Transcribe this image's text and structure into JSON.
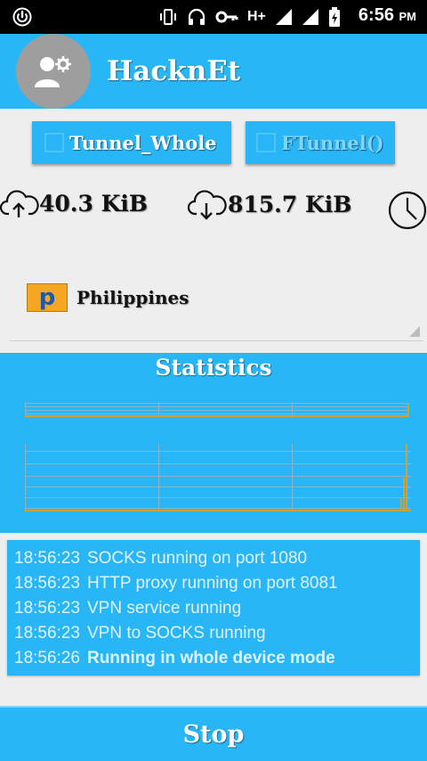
{
  "status_bar": {
    "network_type": "H+",
    "time": "6:56",
    "ampm": "PM",
    "icons": [
      "power-icon",
      "vibrate-icon",
      "headset-icon",
      "key-icon",
      "signal-icon",
      "signal-icon",
      "battery-icon"
    ]
  },
  "header": {
    "title": "HacknEt"
  },
  "modes": [
    {
      "label": "Tunnel_Whole",
      "checked": true
    },
    {
      "label": "FTunnel()",
      "checked": false
    }
  ],
  "traffic": {
    "upload": "40.3 KiB",
    "download": "815.7 KiB"
  },
  "server": {
    "name": "Philippines",
    "flag_letter": "p"
  },
  "statistics": {
    "title": "Statistics"
  },
  "log": {
    "lines": [
      {
        "time": "18:56:23",
        "message": "SOCKS running on port 1080",
        "bold": false
      },
      {
        "time": "18:56:23",
        "message": "HTTP proxy running on port 8081",
        "bold": false
      },
      {
        "time": "18:56:23",
        "message": "VPN service running",
        "bold": false
      },
      {
        "time": "18:56:23",
        "message": "VPN to SOCKS running",
        "bold": false
      },
      {
        "time": "18:56:26",
        "message": "Running in whole device mode",
        "bold": true
      }
    ]
  },
  "actions": {
    "stop_label": "Stop"
  },
  "colors": {
    "accent": "#29b6f6",
    "graph_line": "#c8a23a"
  }
}
